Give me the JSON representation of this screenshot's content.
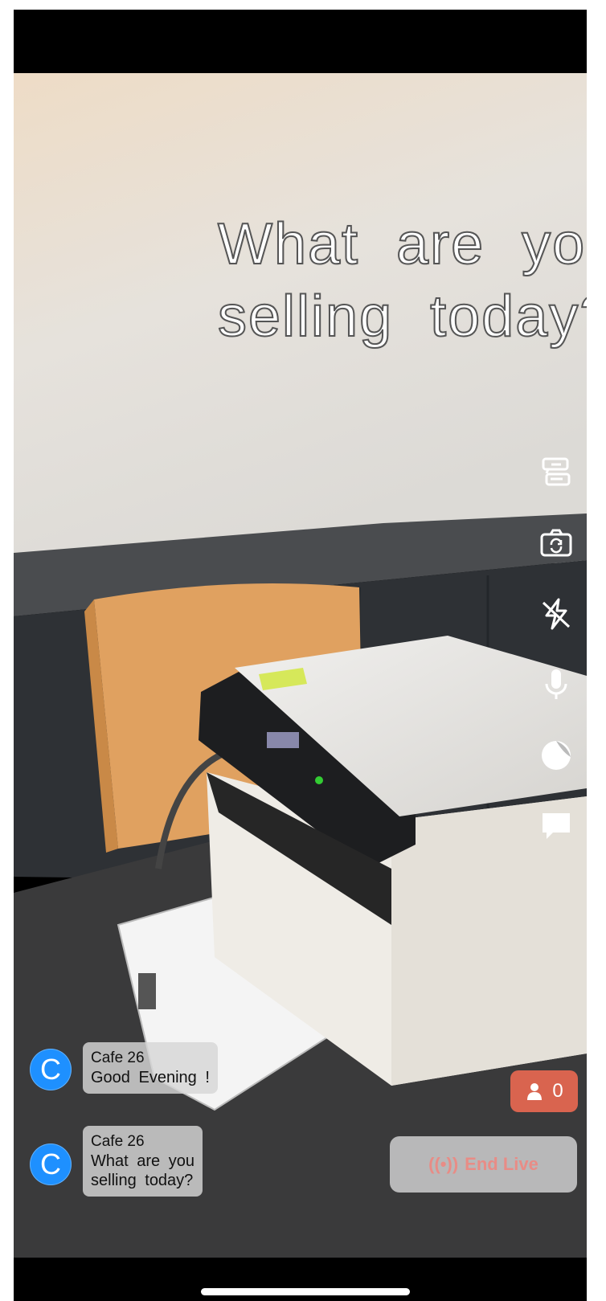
{
  "prompt_text": "What are you\nselling today?",
  "toolbar": {
    "icons": [
      "captions-icon",
      "camera-flip-icon",
      "flash-off-icon",
      "microphone-icon",
      "beauty-filter-icon",
      "chat-icon"
    ]
  },
  "comments": [
    {
      "user": "Cafe 26",
      "message": "Good Evening !",
      "avatar_letter": "C"
    },
    {
      "user": "Cafe 26",
      "message": "What are you\nselling today?",
      "avatar_letter": "C"
    }
  ],
  "viewer_count": "0",
  "end_live": {
    "icon": "((•))",
    "label": "End Live"
  },
  "colors": {
    "avatar": "#1e90ff",
    "viewer_badge": "#d9644f",
    "end_live_text": "#e88c86"
  }
}
